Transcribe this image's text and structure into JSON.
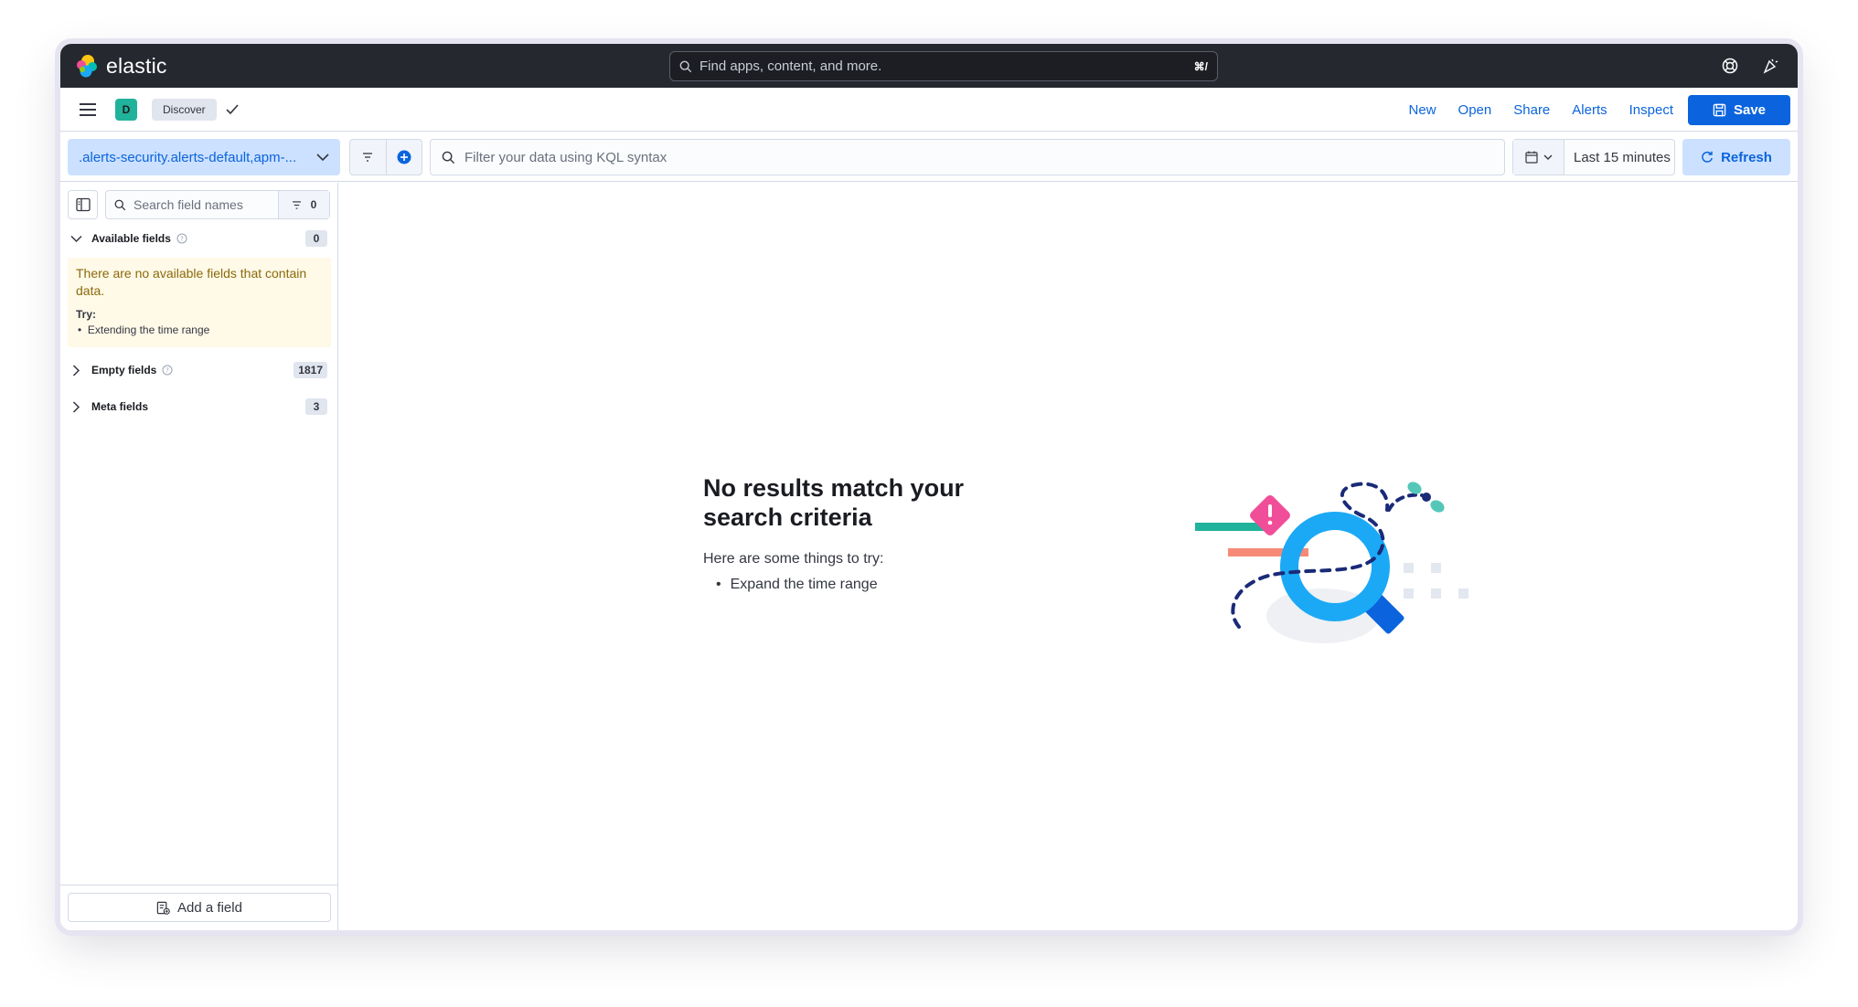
{
  "brand": {
    "name": "elastic"
  },
  "global_search": {
    "placeholder": "Find apps, content, and more.",
    "shortcut": "⌘/"
  },
  "breadcrumb": {
    "space_initial": "D",
    "app": "Discover"
  },
  "top_actions": {
    "new": "New",
    "open": "Open",
    "share": "Share",
    "alerts": "Alerts",
    "inspect": "Inspect",
    "save": "Save"
  },
  "query": {
    "data_view": ".alerts-security.alerts-default,apm-...",
    "kql_placeholder": "Filter your data using KQL syntax",
    "time_range": "Last 15 minutes",
    "refresh": "Refresh"
  },
  "sidebar": {
    "search_placeholder": "Search field names",
    "filter_count": "0",
    "available": {
      "title": "Available fields",
      "count": "0"
    },
    "callout": {
      "message": "There are no available fields that contain data.",
      "try_label": "Try:",
      "tip": "Extending the time range"
    },
    "empty": {
      "title": "Empty fields",
      "count": "1817"
    },
    "meta": {
      "title": "Meta fields",
      "count": "3"
    },
    "add_field": "Add a field"
  },
  "empty_state": {
    "title": "No results match your search criteria",
    "subtitle": "Here are some things to try:",
    "tip": "Expand the time range"
  },
  "colors": {
    "accent": "#0b64dd",
    "accent_light": "#cce1ff",
    "topbar": "#25282f",
    "callout_bg": "#fff9e8",
    "space_badge": "#20b29a"
  }
}
